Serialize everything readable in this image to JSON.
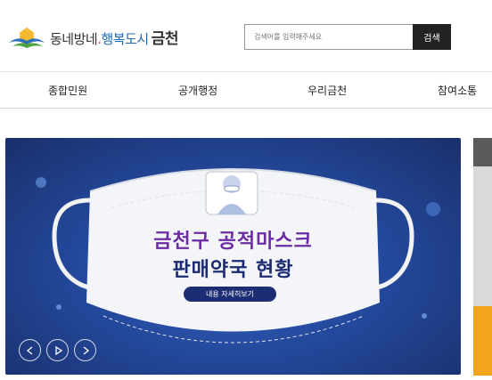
{
  "header": {
    "logo": {
      "part1": "동네방네",
      "dot": ".",
      "part2": "행복도시",
      "city": "금천"
    },
    "search": {
      "placeholder": "검색어를 입력해주세요",
      "button": "검색"
    }
  },
  "nav": {
    "items": [
      "종합민원",
      "공개행정",
      "우리금천",
      "참여소통"
    ]
  },
  "banner": {
    "title_line1": "금천구 공적마스크",
    "title_line2": "판매약국 현황",
    "detail_button": "내용 자세히보기",
    "controls": [
      "prev-icon",
      "play-icon",
      "next-icon"
    ]
  },
  "colors": {
    "banner_bg": "#244a9e",
    "title_purple": "#6b2ca3",
    "title_navy": "#1b2a72",
    "side_orange": "#f2a51c"
  }
}
